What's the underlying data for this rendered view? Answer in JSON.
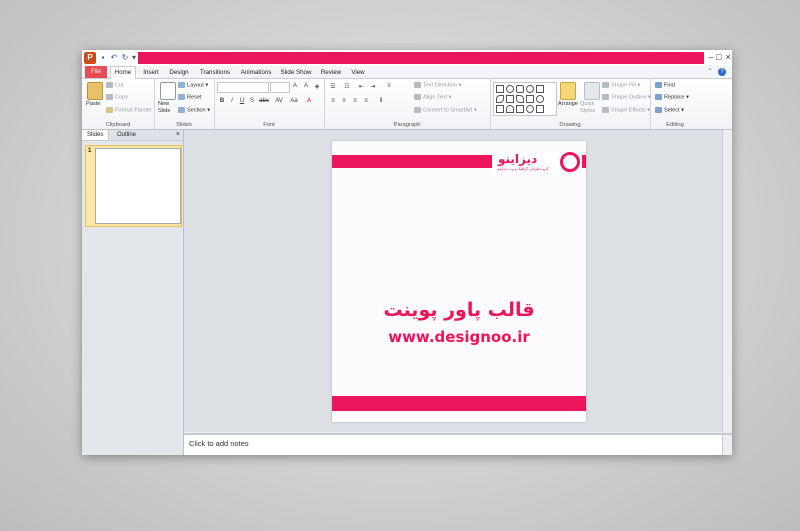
{
  "app": {
    "accent": "#ec145b",
    "window_controls": [
      "–",
      "□",
      "×"
    ]
  },
  "tabs": {
    "file": "File",
    "items": [
      "Home",
      "Insert",
      "Design",
      "Transitions",
      "Animations",
      "Slide Show",
      "Review",
      "View"
    ],
    "active": "Home"
  },
  "ribbon": {
    "clipboard": {
      "paste": "Paste",
      "cut": "Cut",
      "copy": "Copy",
      "format_painter": "Format Painter",
      "label": "Clipboard"
    },
    "slides": {
      "new_slide": "New Slide",
      "layout": "Layout",
      "reset": "Reset",
      "section": "Section",
      "label": "Slides"
    },
    "font": {
      "label": "Font",
      "buttons": [
        "B",
        "I",
        "U",
        "S",
        "abc",
        "AV",
        "Aa",
        "A"
      ]
    },
    "paragraph": {
      "text_direction": "Text Direction",
      "align_text": "Align Text",
      "convert_smartart": "Convert to SmartArt",
      "label": "Paragraph"
    },
    "drawing": {
      "arrange": "Arrange",
      "quick_styles": "Quick Styles",
      "shape_fill": "Shape Fill",
      "shape_outline": "Shape Outline",
      "shape_effects": "Shape Effects",
      "label": "Drawing"
    },
    "editing": {
      "find": "Find",
      "replace": "Replace",
      "select": "Select",
      "label": "Editing"
    }
  },
  "left_panel": {
    "tab_slides": "Slides",
    "tab_outline": "Outline",
    "close": "×",
    "slide_number": "1"
  },
  "slide": {
    "logo_text": "دیزاینو",
    "logo_tagline": "گروه طراحی گرافیک و وب دیزاینو",
    "title": "قالب پاور پوینت",
    "url": "www.designoo.ir"
  },
  "notes": {
    "placeholder": "Click to add notes"
  }
}
